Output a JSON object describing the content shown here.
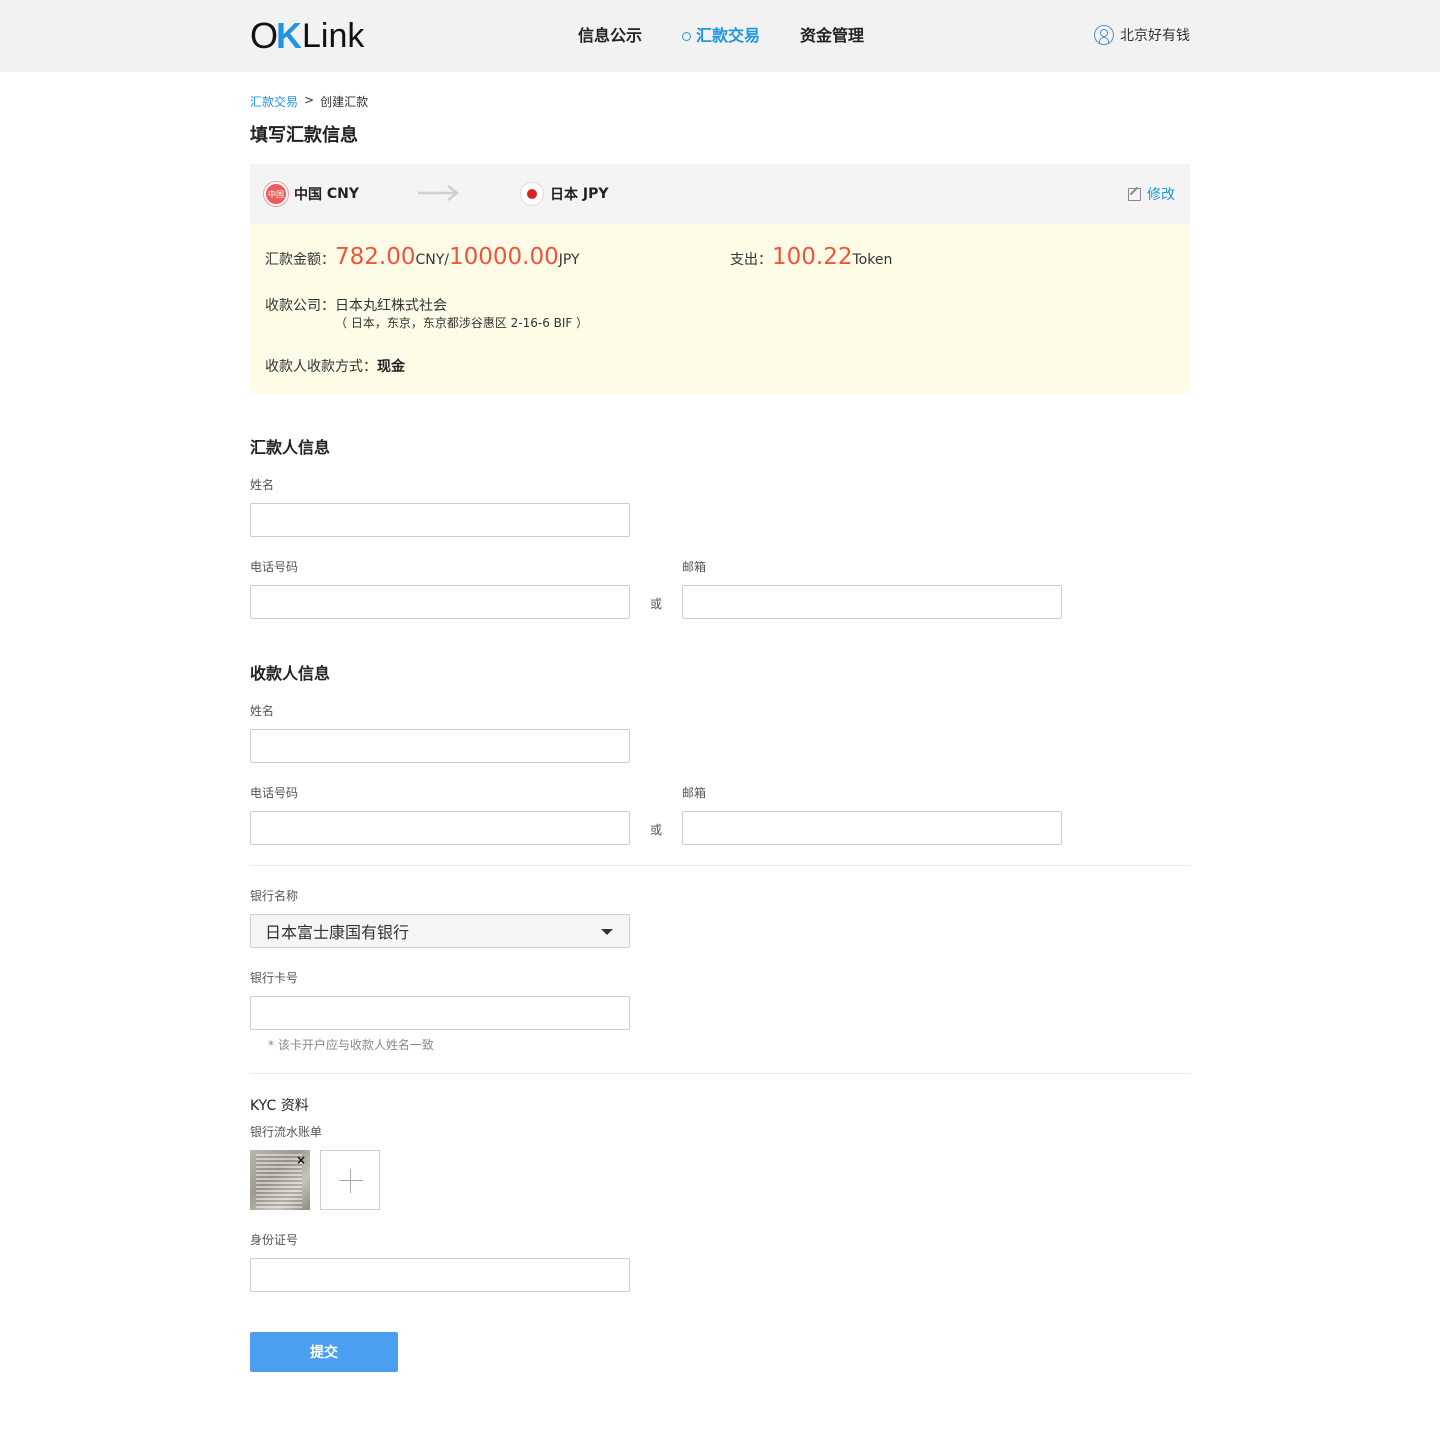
{
  "header": {
    "logo": {
      "ok_o": "O",
      "ok_k": "K",
      "link": "Link"
    },
    "nav": [
      {
        "label": "信息公示",
        "active": false
      },
      {
        "label": "汇款交易",
        "active": true
      },
      {
        "label": "资金管理",
        "active": false
      }
    ],
    "user_name": "北京好有钱"
  },
  "breadcrumb": {
    "parent": "汇款交易",
    "separator": ">",
    "current": "创建汇款"
  },
  "page_title": "填写汇款信息",
  "route": {
    "from_flag_text": "中国",
    "from_country": "中国",
    "from_currency": "CNY",
    "to_country": "日本",
    "to_currency": "JPY",
    "edit_label": "修改"
  },
  "summary": {
    "amount_label": "汇款金额：",
    "amount_cny": "782.00",
    "amount_cny_unit": "CNY/",
    "amount_jpy": "10000.00",
    "amount_jpy_unit": "JPY",
    "expense_label": "支出：",
    "expense_value": "100.22",
    "expense_unit": "Token",
    "company_label": "收款公司：",
    "company_name": "日本丸红株式社会",
    "company_address": "（ 日本，东京，东京都涉谷惠区 2-16-6 BIF ）",
    "method_label": "收款人收款方式：",
    "method_value": "现金"
  },
  "sender": {
    "title": "汇款人信息",
    "name_label": "姓名",
    "phone_label": "电话号码",
    "or": "或",
    "email_label": "邮箱"
  },
  "receiver": {
    "title": "收款人信息",
    "name_label": "姓名",
    "phone_label": "电话号码",
    "or": "或",
    "email_label": "邮箱"
  },
  "bank": {
    "name_label": "银行名称",
    "selected_bank": "日本富士康国有银行",
    "card_label": "银行卡号",
    "card_hint": "* 该卡开户应与收款人姓名一致"
  },
  "kyc": {
    "title": "KYC 资料",
    "statement_label": "银行流水账单",
    "remove": "×",
    "id_label": "身份证号"
  },
  "submit_label": "提交",
  "colors": {
    "accent": "#2196e0",
    "amount_red": "#f0553a",
    "button": "#4a9ff0",
    "summary_bg": "#fefbe6"
  }
}
